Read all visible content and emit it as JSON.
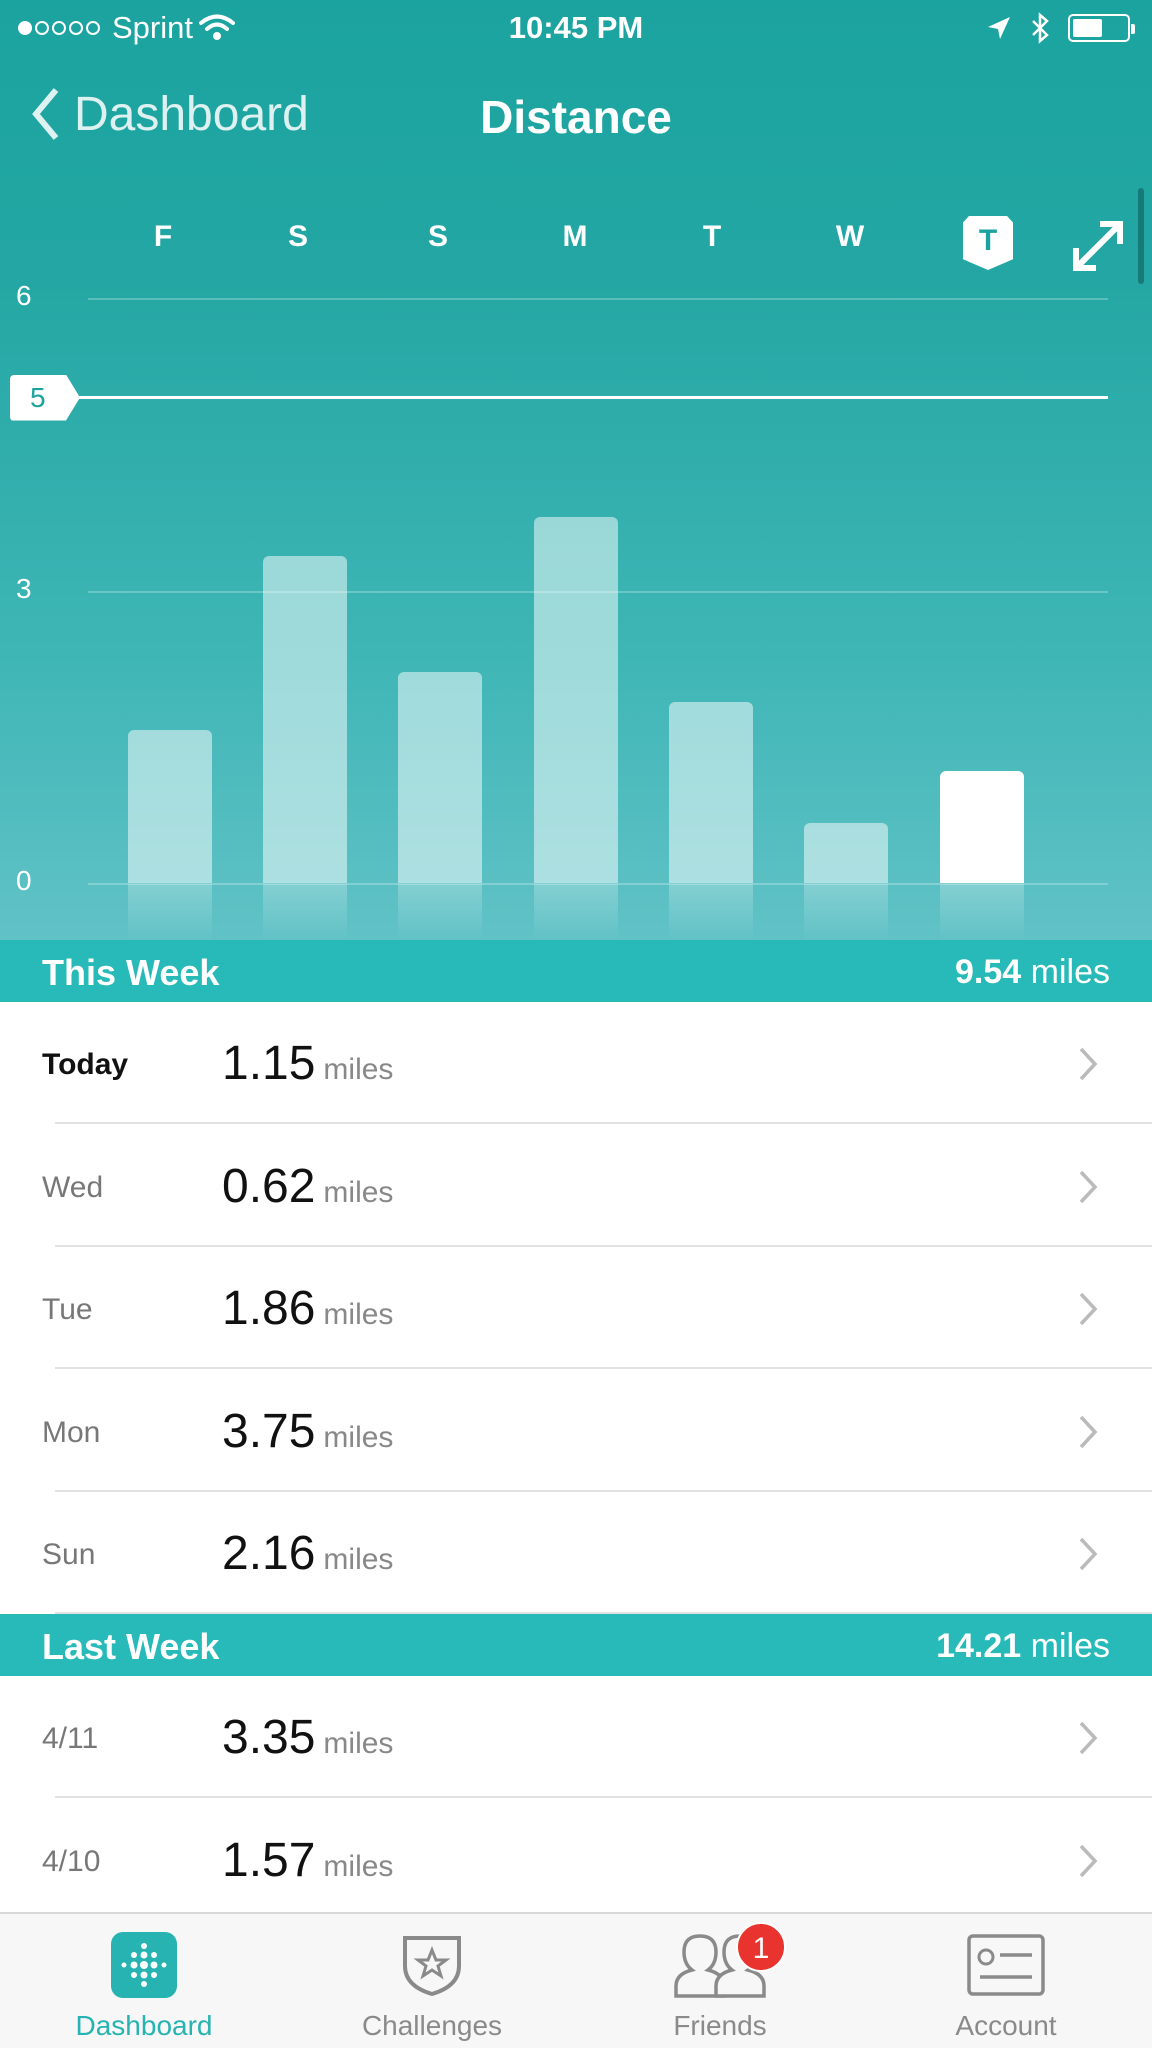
{
  "status": {
    "carrier": "Sprint",
    "time": "10:45 PM",
    "signal_bars": 1,
    "signal_total": 5,
    "battery_level": 0.55
  },
  "nav": {
    "back_label": "Dashboard",
    "title": "Distance"
  },
  "week_days": [
    "F",
    "S",
    "S",
    "M",
    "T",
    "W",
    "T"
  ],
  "selected_day_index": 6,
  "colors": {
    "brand": "#1ba39f",
    "section": "#27bab8",
    "badge": "#e8332e"
  },
  "chart_data": {
    "type": "bar",
    "categories": [
      "F",
      "S",
      "S",
      "M",
      "T",
      "W",
      "T"
    ],
    "values": [
      1.57,
      3.35,
      2.16,
      3.75,
      1.86,
      0.62,
      1.15
    ],
    "ylim": [
      0,
      6
    ],
    "yticks": [
      "0",
      "3",
      "6"
    ],
    "goal": 5,
    "goal_label": "5",
    "highlight_index": 6,
    "grid": true
  },
  "this_week": {
    "label": "This Week",
    "total_value": "9.54",
    "total_unit": "miles",
    "rows": [
      {
        "day": "Today",
        "value": "1.15",
        "unit": "miles"
      },
      {
        "day": "Wed",
        "value": "0.62",
        "unit": "miles"
      },
      {
        "day": "Tue",
        "value": "1.86",
        "unit": "miles"
      },
      {
        "day": "Mon",
        "value": "3.75",
        "unit": "miles"
      },
      {
        "day": "Sun",
        "value": "2.16",
        "unit": "miles"
      }
    ]
  },
  "last_week": {
    "label": "Last Week",
    "total_value": "14.21",
    "total_unit": "miles",
    "rows": [
      {
        "day": "4/11",
        "value": "3.35",
        "unit": "miles"
      },
      {
        "day": "4/10",
        "value": "1.57",
        "unit": "miles"
      }
    ]
  },
  "tabs": [
    {
      "label": "Dashboard",
      "icon": "dashboard-icon"
    },
    {
      "label": "Challenges",
      "icon": "challenges-icon"
    },
    {
      "label": "Friends",
      "icon": "friends-icon",
      "badge": "1"
    },
    {
      "label": "Account",
      "icon": "account-icon"
    }
  ]
}
